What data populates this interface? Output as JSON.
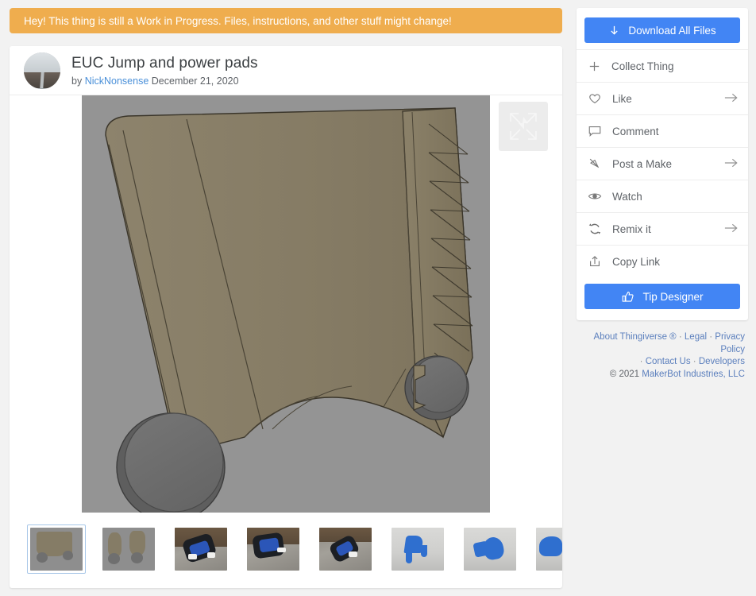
{
  "banner": {
    "text": "Hey! This thing is still a Work in Progress. Files, instructions, and other stuff might change!",
    "color": "#efad4e"
  },
  "thing": {
    "title": "EUC Jump and power pads",
    "by_prefix": "by",
    "author": "NickNonsense",
    "date": "December 21, 2020",
    "avatar_icon": "user-avatar-photo"
  },
  "viewer": {
    "expand_icon": "fullscreen-expand-icon",
    "render_background": "#949494",
    "part_color": "#877d66",
    "hub_color": "#6f6f6f"
  },
  "thumbnails": {
    "next_arrow_icon": "chevron-right-icon",
    "items": [
      {
        "label": "CAD render front view",
        "kind": "cad-a",
        "selected": true
      },
      {
        "label": "CAD render side pair",
        "kind": "cad-b",
        "selected": false
      },
      {
        "label": "EUC photo held in hand",
        "kind": "photo-a",
        "selected": false
      },
      {
        "label": "EUC photo on pavement",
        "kind": "photo-b",
        "selected": false
      },
      {
        "label": "EUC photo angled",
        "kind": "photo-c",
        "selected": false
      },
      {
        "label": "Blue printed pad on bed",
        "kind": "print-a",
        "selected": false
      },
      {
        "label": "Blue printed knob on bed",
        "kind": "print-b",
        "selected": false
      },
      {
        "label": "Blue printed part partial",
        "kind": "print-c",
        "selected": false
      }
    ]
  },
  "sidebar": {
    "accent_color": "#4285f4",
    "download": {
      "label": "Download All Files",
      "icon": "download-arrow-icon"
    },
    "actions": [
      {
        "label": "Collect Thing",
        "icon": "plus-icon",
        "chevron": false
      },
      {
        "label": "Like",
        "icon": "heart-icon",
        "chevron": true
      },
      {
        "label": "Comment",
        "icon": "comment-bubble-icon",
        "chevron": false
      },
      {
        "label": "Post a Make",
        "icon": "post-make-icon",
        "chevron": true
      },
      {
        "label": "Watch",
        "icon": "eye-icon",
        "chevron": false
      },
      {
        "label": "Remix it",
        "icon": "remix-refresh-icon",
        "chevron": true
      },
      {
        "label": "Copy Link",
        "icon": "share-upload-icon",
        "chevron": false
      }
    ],
    "tip": {
      "label": "Tip Designer",
      "icon": "thumbs-up-icon"
    }
  },
  "footer": {
    "links_line1": [
      "About Thingiverse ®",
      "Legal",
      "Privacy Policy"
    ],
    "links_line2": [
      "Contact Us",
      "Developers"
    ],
    "copyright_symbol": "©",
    "copyright_year": "2021",
    "copyright_owner": "MakerBot Industries, LLC",
    "separator": "·"
  }
}
